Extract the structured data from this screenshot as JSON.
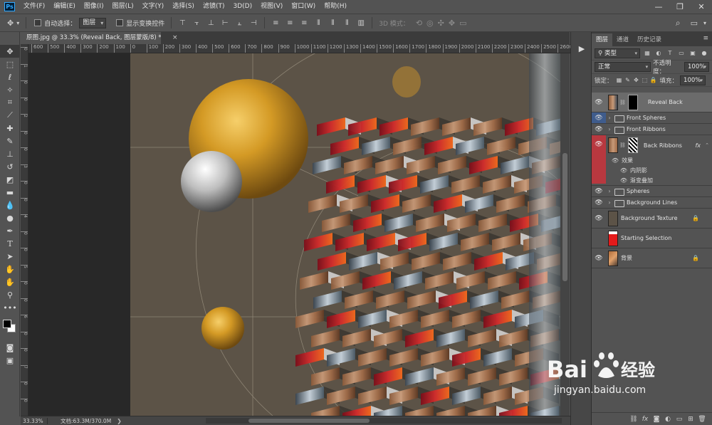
{
  "app": {
    "logo": "Ps"
  },
  "menu": [
    "文件(F)",
    "编辑(E)",
    "图像(I)",
    "图层(L)",
    "文字(Y)",
    "选择(S)",
    "滤镜(T)",
    "3D(D)",
    "视图(V)",
    "窗口(W)",
    "帮助(H)"
  ],
  "window_controls": {
    "minimize": "—",
    "restore": "❐",
    "close": "✕"
  },
  "options": {
    "auto_select_label": "自动选择：",
    "auto_select_value": "图层",
    "show_transform_label": "显示变换控件",
    "mode_3d_label": "3D 模式："
  },
  "document": {
    "tab_title": "原图.jpg @ 33.3% (Reveal Back, 图层蒙版/8) *",
    "close": "×",
    "zoom": "33.33%",
    "doc_size": "文档:63.3M/370.0M"
  },
  "ruler": {
    "h_ticks": [
      "600",
      "500",
      "400",
      "300",
      "200",
      "100",
      "0",
      "100",
      "200",
      "300",
      "400",
      "500",
      "600",
      "700",
      "800",
      "900",
      "1000",
      "1100",
      "1200",
      "1300",
      "1400",
      "1500",
      "1600",
      "1700",
      "1800",
      "1900",
      "2000",
      "2100",
      "2200",
      "2300",
      "2400",
      "2500",
      "2600"
    ],
    "v_ticks": [
      "0",
      "1",
      "0",
      "0",
      "2",
      "0",
      "0",
      "3",
      "0",
      "0",
      "4",
      "0",
      "0",
      "5",
      "0",
      "0",
      "6",
      "0",
      "0",
      "7",
      "0",
      "0"
    ]
  },
  "colors": {
    "accent_red": "#b8383f",
    "accent_blue": "#3f5c8c",
    "canvas_bg": "#5c5347",
    "gold": "#d9a22c"
  },
  "layers_panel": {
    "tabs": [
      "图层",
      "通道",
      "历史记录"
    ],
    "filter_kind": "类型",
    "blend_mode": "正常",
    "opacity_label": "不透明度：",
    "opacity_value": "100%",
    "lock_label": "锁定：",
    "fill_label": "填充：",
    "fill_value": "100%",
    "layers": [
      {
        "name": "Reveal Back",
        "type": "layer-mask",
        "visible": true,
        "selected": true
      },
      {
        "name": "Front Spheres",
        "type": "group",
        "visible": true,
        "tag": "blue"
      },
      {
        "name": "Front Ribbons",
        "type": "group",
        "visible": true
      },
      {
        "name": "Back Ribbons",
        "type": "layer-fx",
        "visible": true,
        "tag": "red",
        "fx": "fx"
      },
      {
        "name": "Spheres",
        "type": "group",
        "visible": true
      },
      {
        "name": "Background Lines",
        "type": "group",
        "visible": true
      },
      {
        "name": "Background Texture",
        "type": "fill",
        "visible": true,
        "locked": true
      },
      {
        "name": "Starting Selection",
        "type": "red-layer",
        "visible": false
      },
      {
        "name": "背景",
        "type": "photo",
        "visible": true,
        "locked": true
      }
    ],
    "effects_label": "效果",
    "effects": [
      "内阴影",
      "渐变叠加"
    ]
  },
  "watermark": {
    "logo": "Bai🐾百度 经验",
    "logo_text": "Bai",
    "logo_cn": "经验",
    "sub": "jingyan.baidu.com"
  }
}
